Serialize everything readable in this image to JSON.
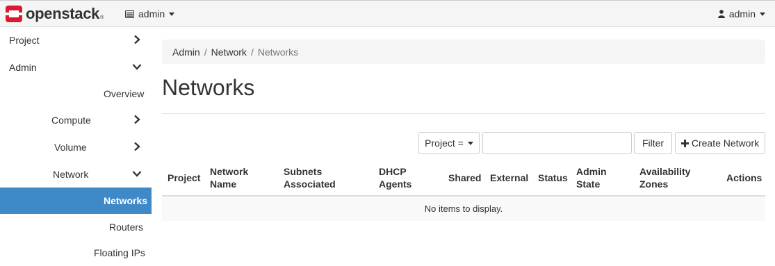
{
  "navbar": {
    "brand": "openstack",
    "brand_mark": "®",
    "project": "admin",
    "user": "admin"
  },
  "sidebar": {
    "items": [
      {
        "label": "Project",
        "chevron": "right"
      },
      {
        "label": "Admin",
        "chevron": "down"
      },
      {
        "label": "Overview",
        "chevron": ""
      },
      {
        "label": "Compute",
        "chevron": "right"
      },
      {
        "label": "Volume",
        "chevron": "right"
      },
      {
        "label": "Network",
        "chevron": "down"
      },
      {
        "label": "Networks",
        "chevron": "",
        "active": true
      },
      {
        "label": "Routers",
        "chevron": ""
      },
      {
        "label": "Floating IPs",
        "chevron": ""
      }
    ]
  },
  "breadcrumb": [
    "Admin",
    "Network",
    "Networks"
  ],
  "page_title": "Networks",
  "toolbar": {
    "filter_field": "Project =",
    "filter_input_value": "",
    "filter_button": "Filter",
    "create_button": "Create Network"
  },
  "table": {
    "headers": [
      [
        "Project"
      ],
      [
        "Network",
        "Name"
      ],
      [
        "Subnets",
        "Associated"
      ],
      [
        "DHCP",
        "Agents"
      ],
      [
        "Shared"
      ],
      [
        "External"
      ],
      [
        "Status"
      ],
      [
        "Admin",
        "State"
      ],
      [
        "Availability",
        "Zones"
      ],
      [
        "Actions"
      ]
    ],
    "empty_text": "No items to display."
  },
  "colors": {
    "brand_red": "#da1a32",
    "active_sidebar": "#3f89c9"
  }
}
